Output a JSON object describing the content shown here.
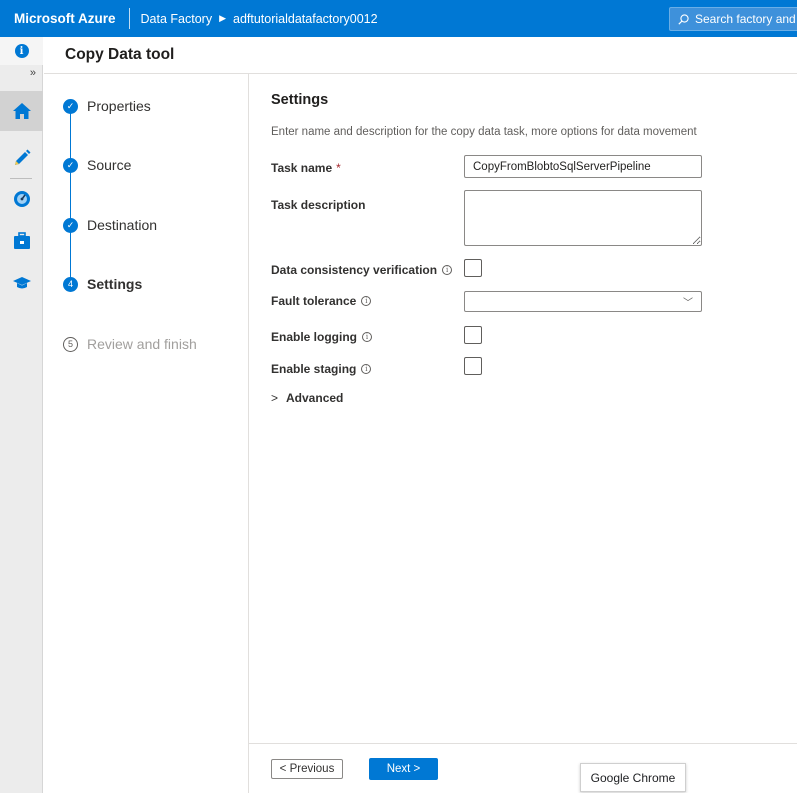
{
  "topbar": {
    "brand": "Microsoft Azure",
    "breadcrumb_service": "Data Factory",
    "breadcrumb_factory": "adftutorialdatafactory0012",
    "search_placeholder": "Search factory and d"
  },
  "page": {
    "title": "Copy Data tool"
  },
  "steps": [
    {
      "label": "Properties",
      "state": "done"
    },
    {
      "label": "Source",
      "state": "done"
    },
    {
      "label": "Destination",
      "state": "done"
    },
    {
      "label": "Settings",
      "state": "active",
      "number": "4"
    },
    {
      "label": "Review and finish",
      "state": "future",
      "number": "5"
    }
  ],
  "settings": {
    "title": "Settings",
    "description": "Enter name and description for the copy data task, more options for data movement",
    "task_name_label": "Task name",
    "task_name_required": "*",
    "task_name_value": "CopyFromBlobtoSqlServerPipeline",
    "task_description_label": "Task description",
    "task_description_value": "",
    "data_consistency_label": "Data consistency verification",
    "fault_tolerance_label": "Fault tolerance",
    "fault_tolerance_value": "",
    "enable_logging_label": "Enable logging",
    "enable_staging_label": "Enable staging",
    "advanced_label": "Advanced"
  },
  "footer": {
    "previous_label": "< Previous",
    "next_label": "Next >"
  },
  "tooltip": {
    "text": "Google Chrome"
  },
  "colors": {
    "accent": "#0078d4",
    "required": "#a4262c"
  }
}
